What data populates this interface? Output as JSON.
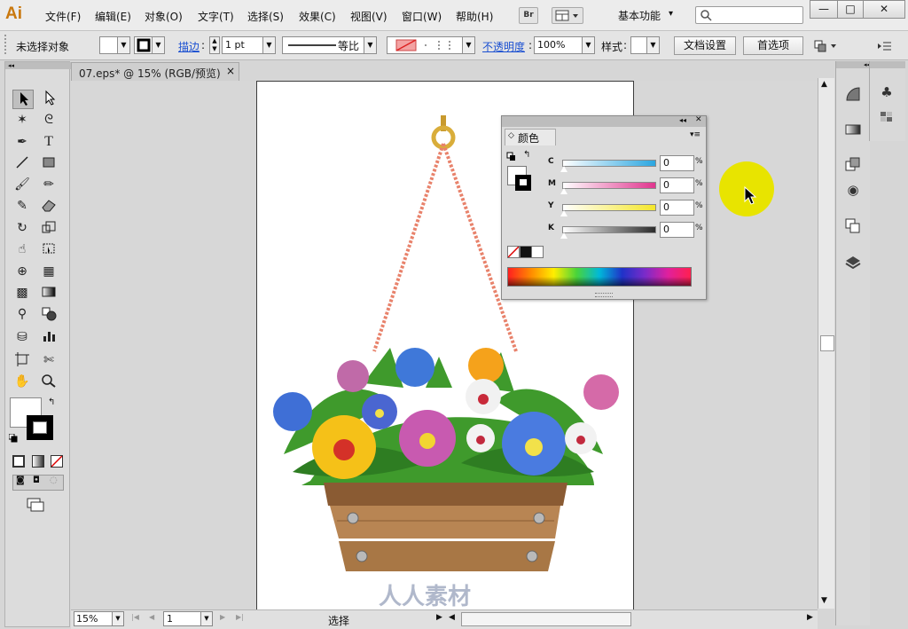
{
  "app": {
    "logo": "Ai"
  },
  "menu": [
    "文件(F)",
    "编辑(E)",
    "对象(O)",
    "文字(T)",
    "选择(S)",
    "效果(C)",
    "视图(V)",
    "窗口(W)",
    "帮助(H)"
  ],
  "menubar": {
    "bridge_label": "Br",
    "workspace": "基本功能",
    "workspace_arrow": "▾",
    "search_placeholder": ""
  },
  "window_buttons": {
    "minimize": "—",
    "maximize": "□",
    "close": "✕"
  },
  "control": {
    "selection_status": "未选择对象",
    "stroke_label": "描边",
    "stroke_weight": "1 pt",
    "stroke_profile": "等比",
    "opacity_label": "不透明度",
    "opacity_value": "100%",
    "style_label": "样式",
    "doc_setup": "文档设置",
    "preferences": "首选项"
  },
  "document": {
    "tab_title": "07.eps* @ 15% (RGB/预览)",
    "close": "×"
  },
  "color_panel": {
    "title": "颜色",
    "sliders": [
      {
        "label": "C",
        "value": "0",
        "unit": "%",
        "colors": [
          "#ffffff",
          "#2ba6e0"
        ]
      },
      {
        "label": "M",
        "value": "0",
        "unit": "%",
        "colors": [
          "#ffffff",
          "#e0358e"
        ]
      },
      {
        "label": "Y",
        "value": "0",
        "unit": "%",
        "colors": [
          "#ffffff",
          "#f4e62a"
        ]
      },
      {
        "label": "K",
        "value": "0",
        "unit": "%",
        "colors": [
          "#ffffff",
          "#2c2c2c"
        ]
      }
    ]
  },
  "status": {
    "zoom": "15%",
    "page": "1",
    "tool": "选择"
  },
  "tools": [
    "selection-tool",
    "direct-selection-tool",
    "magic-wand-tool",
    "lasso-tool",
    "pen-tool",
    "type-tool",
    "line-tool",
    "rectangle-tool",
    "paintbrush-tool",
    "pencil-tool",
    "blob-brush-tool",
    "eraser-tool",
    "rotate-tool",
    "scale-tool",
    "warp-tool",
    "free-transform-tool",
    "shape-builder-tool",
    "perspective-grid-tool",
    "mesh-tool",
    "gradient-tool",
    "eyedropper-tool",
    "blend-tool",
    "symbol-sprayer-tool",
    "column-graph-tool",
    "artboard-tool",
    "slice-tool",
    "hand-tool",
    "zoom-tool"
  ],
  "watermark": "人人素材"
}
